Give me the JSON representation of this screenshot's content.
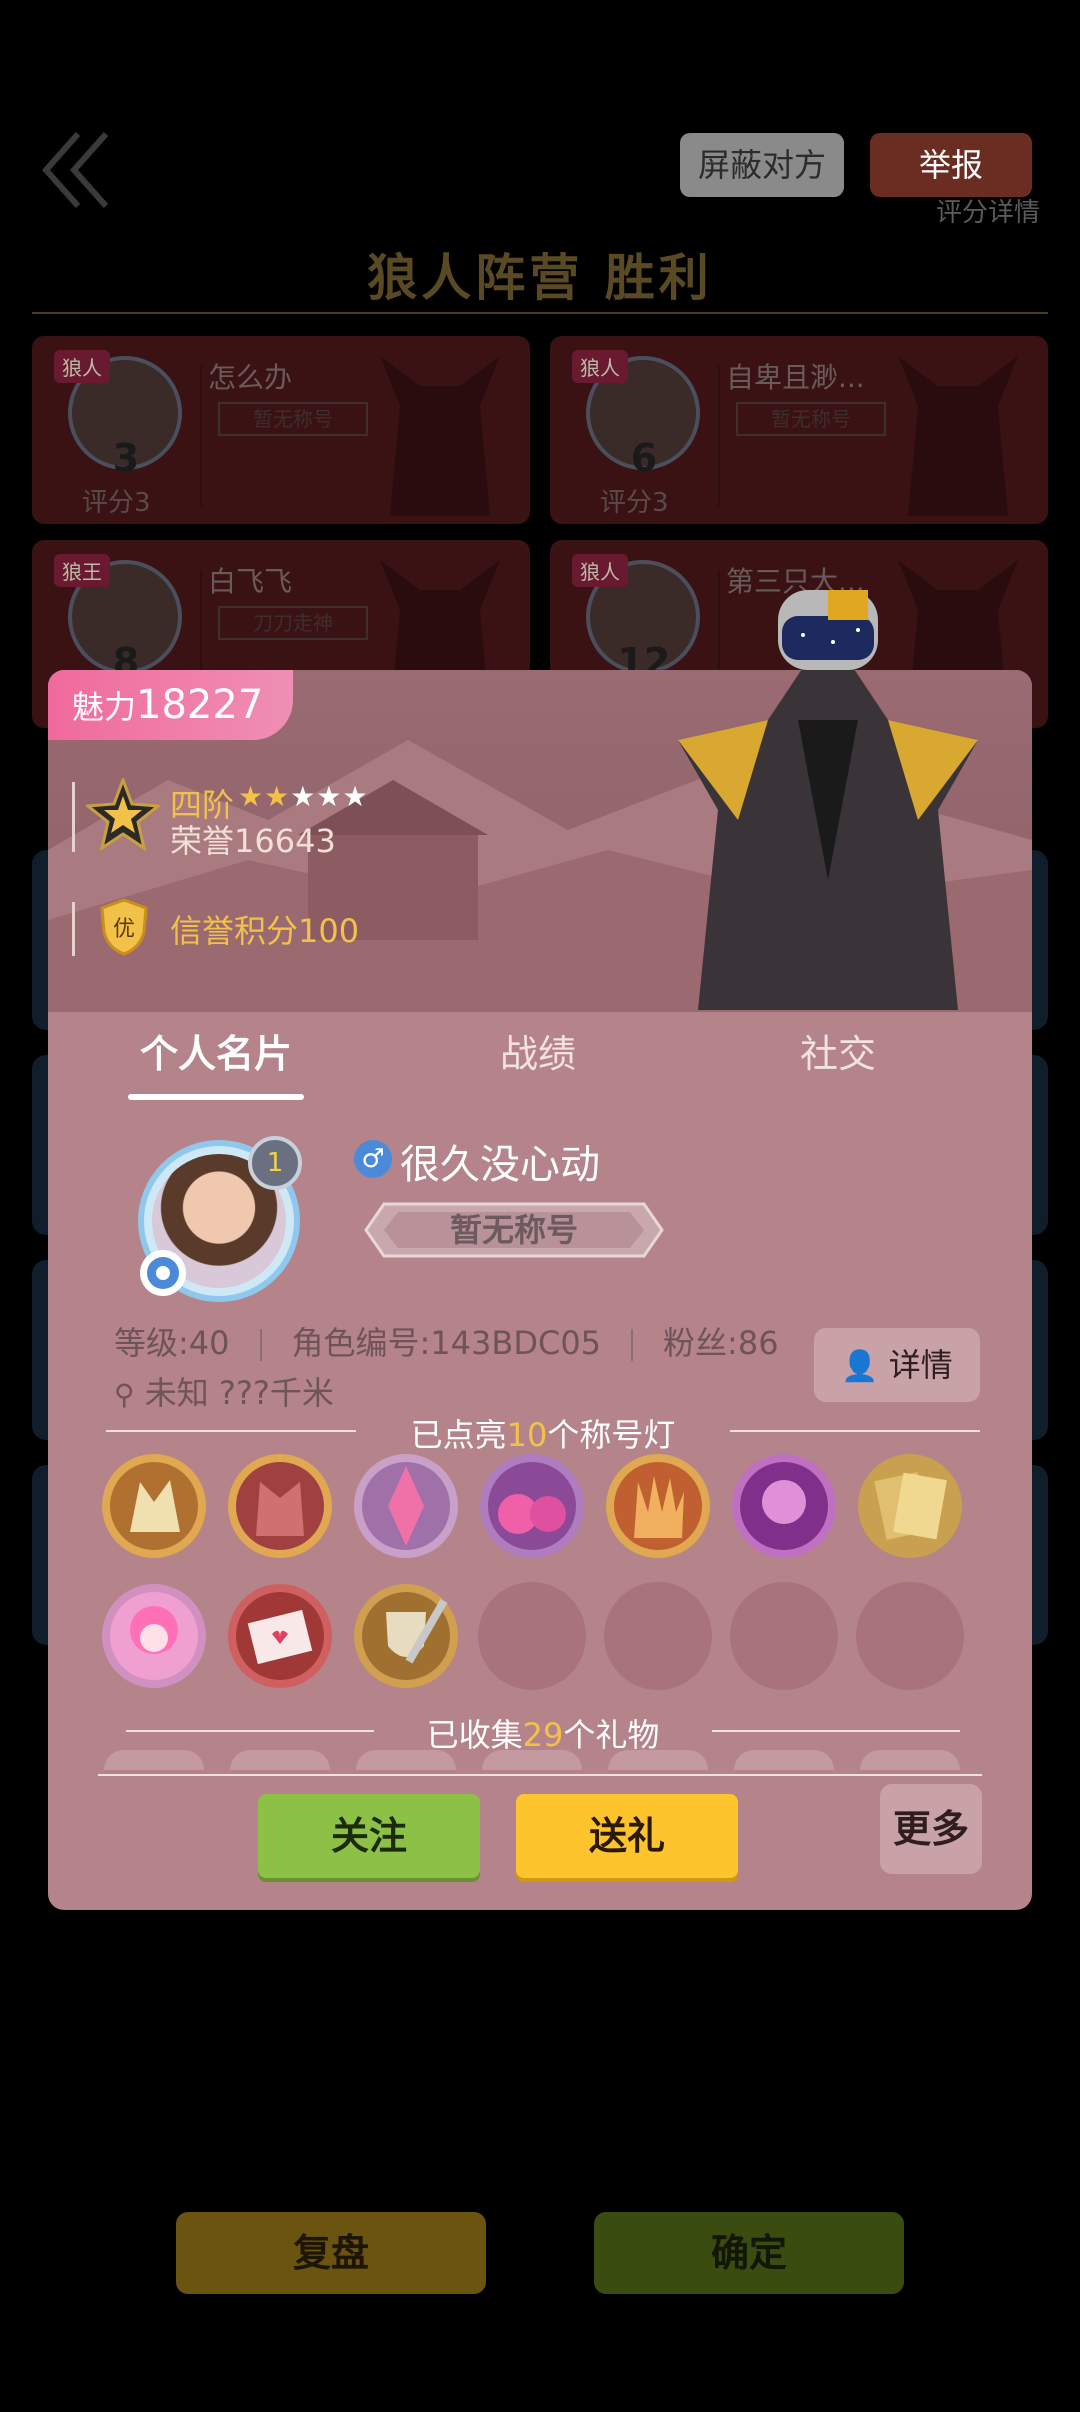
{
  "background": {
    "back_icon": "double-chevron-left-icon",
    "block_label": "屏蔽对方",
    "report_label": "举报",
    "rating_detail": "评分详情",
    "result_title": "狼人阵营  胜利",
    "players": [
      {
        "role": "狼人",
        "seat": "3",
        "name": "怎么办",
        "title": "暂无称号",
        "score": "评分3"
      },
      {
        "role": "狼人",
        "seat": "6",
        "name": "自卑且渺...",
        "title": "暂无称号",
        "score": "评分3"
      },
      {
        "role": "狼王",
        "seat": "8",
        "name": "白飞飞",
        "title": "刀刀走神",
        "score": ""
      },
      {
        "role": "狼人",
        "seat": "12",
        "name": "第三只大...",
        "title": "",
        "score": ""
      }
    ],
    "replay_label": "复盘",
    "confirm_label": "确定"
  },
  "profile": {
    "charm_label": "魅力",
    "charm_value": "18227",
    "rank_name": "四阶",
    "rank_stars_filled": 2,
    "rank_stars_total": 5,
    "honor": "荣誉16643",
    "credit_badge": "优",
    "credit": "信誉积分100",
    "tabs": [
      {
        "label": "个人名片",
        "active": true
      },
      {
        "label": "战绩",
        "active": false
      },
      {
        "label": "社交",
        "active": false
      }
    ],
    "level": "1",
    "gender_symbol": "♂",
    "nickname": "很久没心动",
    "title": "暂无称号",
    "stat_level": "等级:40",
    "stat_id": "角色编号:143BDC05",
    "stat_fans": "粉丝:86",
    "location": "未知   ???千米",
    "detail_label": "详情",
    "badges_prefix": "已点亮",
    "badges_count": "10",
    "badges_suffix": "个称号灯",
    "badges": [
      "wolf-head-icon",
      "werewolf-icon",
      "crystal-icon",
      "potion-icon",
      "claw-hand-icon",
      "witch-icon",
      "couple-card-icon",
      "girl-mascot-icon",
      "love-letter-icon",
      "shield-sword-icon"
    ],
    "empty_badge_slots": 4,
    "gifts_prefix": "已收集",
    "gifts_count": "29",
    "gifts_suffix": "个礼物",
    "follow_label": "关注",
    "send_gift_label": "送礼",
    "more_label": "更多"
  }
}
